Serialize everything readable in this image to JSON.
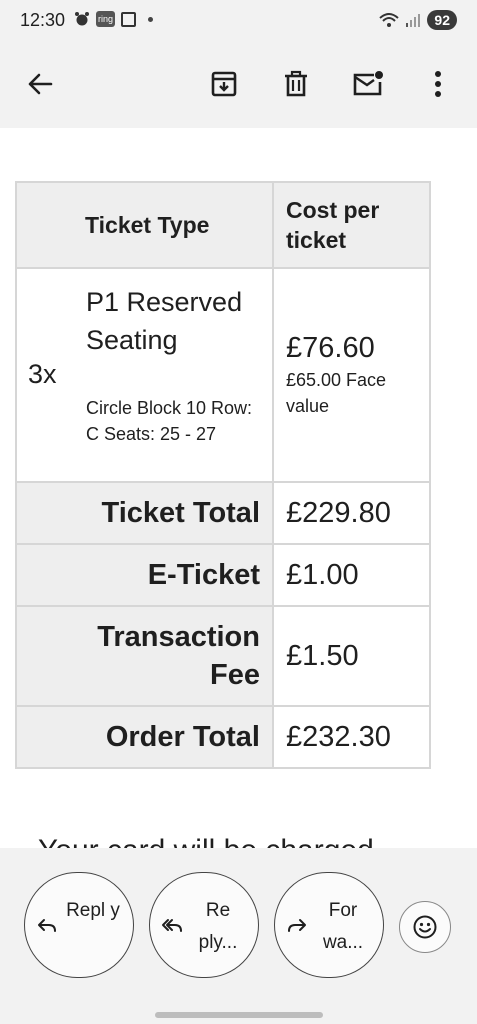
{
  "status_bar": {
    "time": "12:30",
    "ring_badge": "ring",
    "battery": "92"
  },
  "toolbar": {
    "back_icon": "arrow-left-icon",
    "archive_icon": "archive-icon",
    "delete_icon": "trash-icon",
    "unread_icon": "mark-unread-icon",
    "more_icon": "more-vert-icon"
  },
  "ticket_table": {
    "header_type": "Ticket Type",
    "header_cost": "Cost per ticket",
    "item": {
      "quantity": "3x",
      "name": "P1 Reserved Seating",
      "detail": "Circle Block 10 Row: C Seats: 25 - 27",
      "price": "£76.60",
      "face_value": "£65.00 Face value"
    },
    "summary": [
      {
        "label": "Ticket Total",
        "value": "£229.80"
      },
      {
        "label": "E-Ticket",
        "value": "£1.00"
      },
      {
        "label": "Transaction Fee",
        "value": "£1.50"
      },
      {
        "label": "Order Total",
        "value": "£232.30"
      }
    ]
  },
  "cut_off_text": "Your card will be charged",
  "reply_bar": {
    "reply_label": "Repl y",
    "reply_all_label": "Re ply...",
    "forward_label": "For wa...",
    "emoji_icon": "smiley-icon"
  }
}
